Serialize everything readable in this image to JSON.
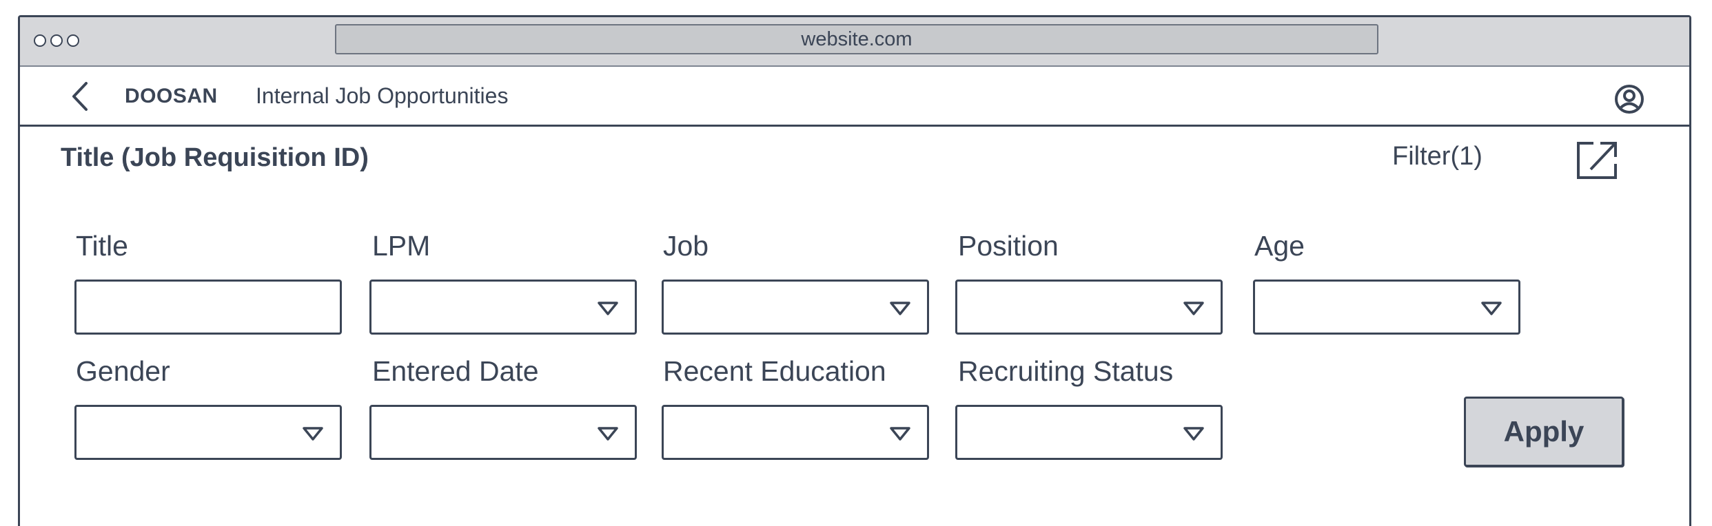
{
  "browser": {
    "url": "website.com"
  },
  "appbar": {
    "brand": "DOOSAN",
    "title": "Internal Job Opportunities"
  },
  "page": {
    "heading": "Title (Job Requisition ID)",
    "filter_label": "Filter(1)"
  },
  "filters": [
    {
      "label": "Title",
      "type": "text",
      "value": ""
    },
    {
      "label": "LPM",
      "type": "select",
      "value": ""
    },
    {
      "label": "Job",
      "type": "select",
      "value": ""
    },
    {
      "label": "Position",
      "type": "select",
      "value": ""
    },
    {
      "label": "Age",
      "type": "select",
      "value": ""
    },
    {
      "label": "Gender",
      "type": "select",
      "value": ""
    },
    {
      "label": "Entered Date",
      "type": "select",
      "value": ""
    },
    {
      "label": "Recent Education",
      "type": "select",
      "value": ""
    },
    {
      "label": "Recruiting Status",
      "type": "select",
      "value": ""
    }
  ],
  "actions": {
    "apply_label": "Apply"
  },
  "icons": [
    "back-icon",
    "profile-icon",
    "external-link-icon",
    "dropdown-caret-icon"
  ],
  "colors": {
    "ink": "#3b4556",
    "chrome": "#d6d7da",
    "button": "#d4d6da"
  }
}
